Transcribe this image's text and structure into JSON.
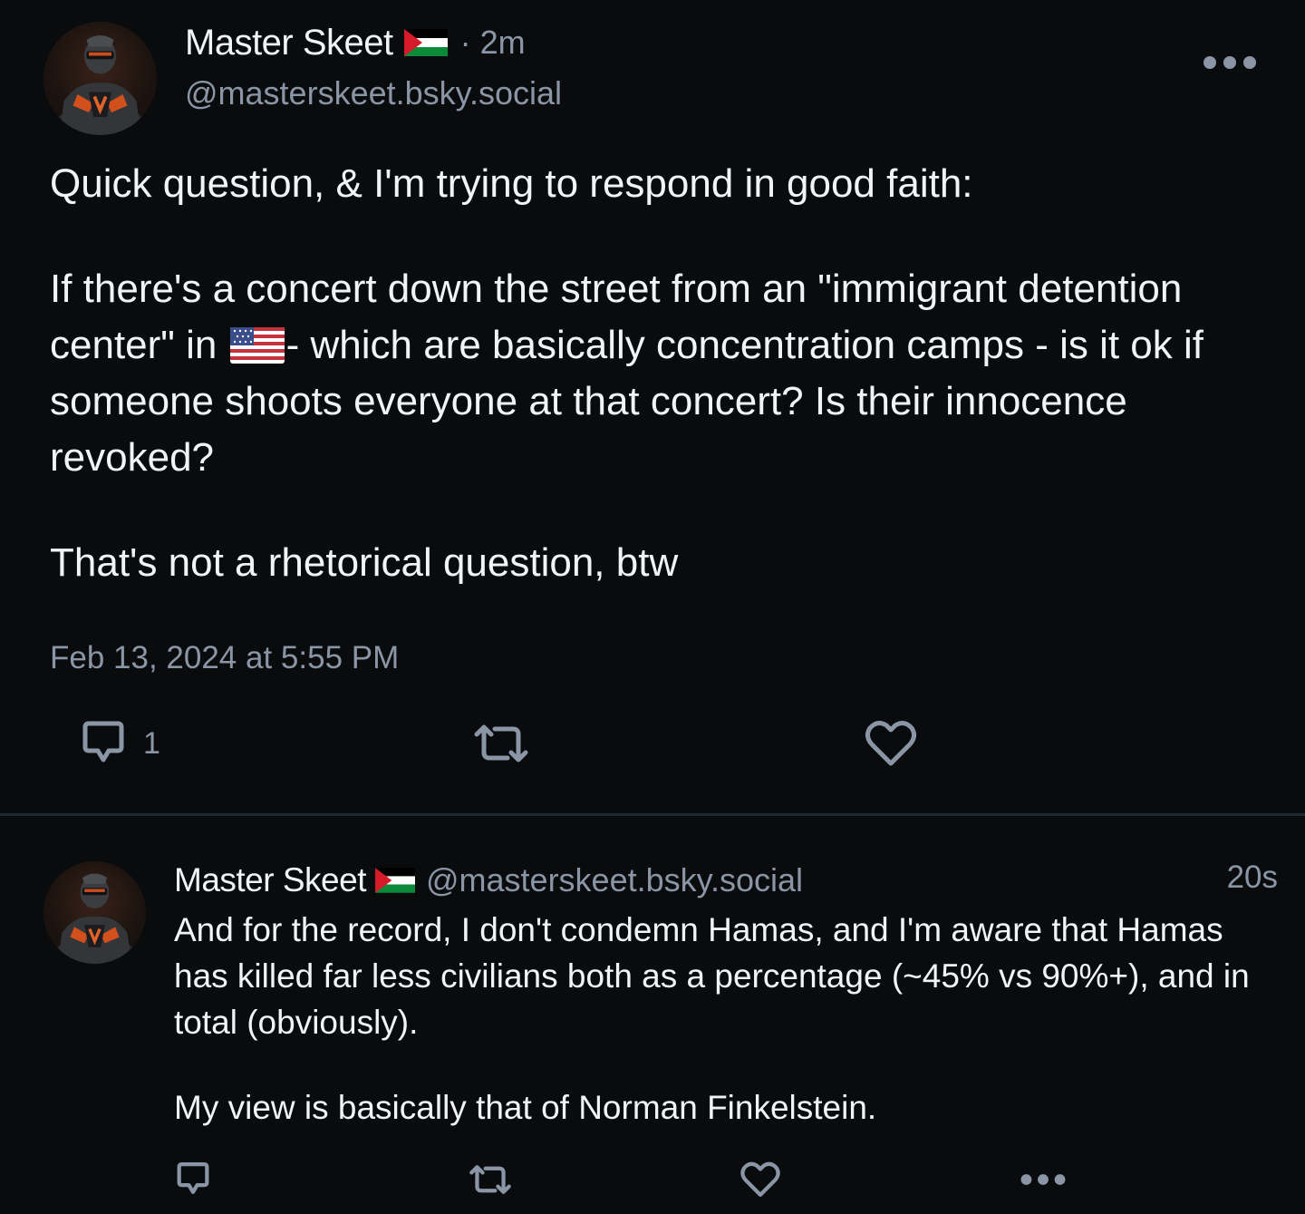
{
  "main_post": {
    "author": {
      "display_name": "Master Skeet",
      "flag_icon": "palestine-flag-icon",
      "time_ago": "· 2m",
      "handle": "@masterskeet.bsky.social"
    },
    "body": {
      "p1": "Quick question, & I'm trying to respond in good faith:",
      "p2_before_flag": "If there's a concert down the street from an \"immigrant detention center\" in ",
      "p2_flag_icon": "us-flag-icon",
      "p2_after_flag": "- which are basically concentration camps - is it ok if someone shoots everyone at that concert? Is their innocence revoked?",
      "p3": "That's not a rhetorical question, btw"
    },
    "timestamp": "Feb 13, 2024 at 5:55 PM",
    "actions": {
      "reply_count": "1",
      "reply_icon": "comment-icon",
      "repost_icon": "repost-icon",
      "like_icon": "heart-icon",
      "more_icon": "more-dots-icon"
    }
  },
  "reply_post": {
    "author": {
      "display_name": "Master Skeet",
      "flag_icon": "palestine-flag-icon",
      "handle": "@masterskeet.bsky.social"
    },
    "time_ago": "20s",
    "body": {
      "p1": "And for the record, I don't condemn Hamas, and I'm aware that Hamas has killed far less civilians both as a percentage (~45% vs 90%+), and in total (obviously).",
      "p2": "My view is basically that of Norman Finkelstein."
    },
    "actions": {
      "reply_icon": "comment-icon",
      "repost_icon": "repost-icon",
      "like_icon": "heart-icon",
      "more_icon": "more-dots-icon"
    }
  },
  "colors": {
    "background": "#0a0b0d",
    "text": "#f1f3f5",
    "muted": "#8a96a6",
    "divider": "#1f2933"
  }
}
